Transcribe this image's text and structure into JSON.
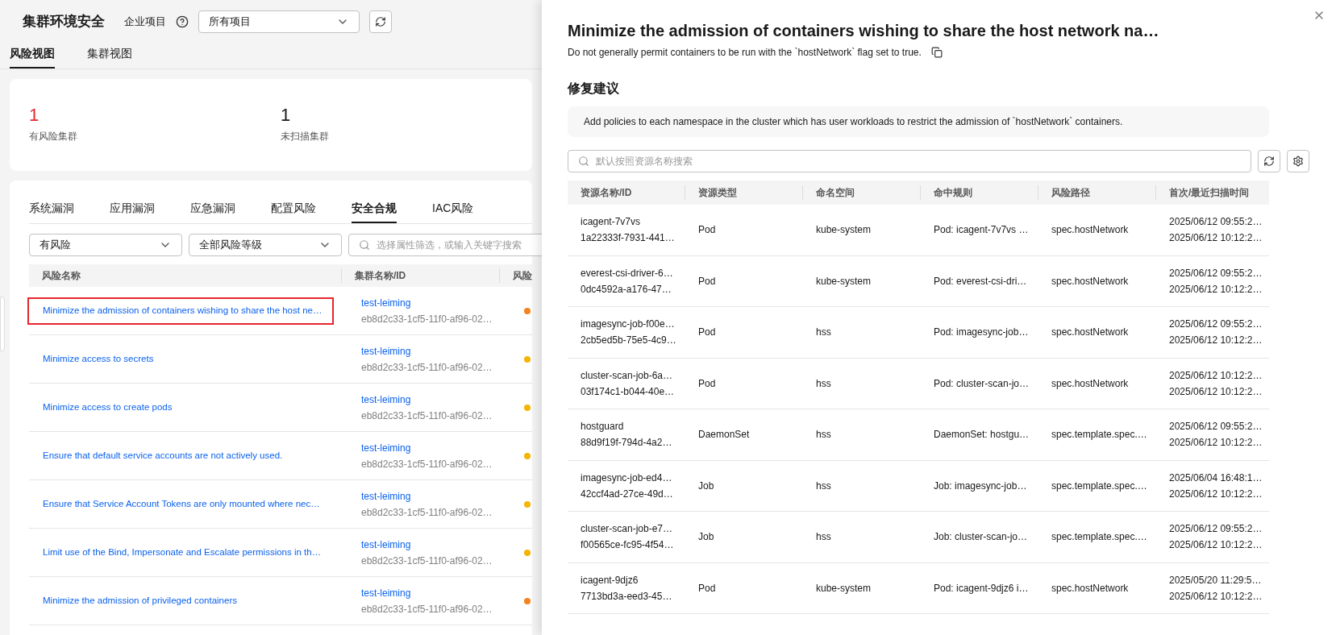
{
  "header": {
    "title": "集群环境安全",
    "project_label": "企业项目",
    "project_select": "所有项目"
  },
  "view_tabs": [
    {
      "label": "风险视图",
      "selected": true
    },
    {
      "label": "集群视图",
      "selected": false
    }
  ],
  "stats": [
    {
      "value": "1",
      "label": "有风险集群",
      "alert": true
    },
    {
      "value": "1",
      "label": "未扫描集群",
      "alert": false
    }
  ],
  "risk_tabs": [
    {
      "label": "系统漏洞",
      "selected": false
    },
    {
      "label": "应用漏洞",
      "selected": false
    },
    {
      "label": "应急漏洞",
      "selected": false
    },
    {
      "label": "配置风险",
      "selected": false
    },
    {
      "label": "安全合规",
      "selected": true
    },
    {
      "label": "IAC风险",
      "selected": false
    }
  ],
  "filters": {
    "status": "有风险",
    "level": "全部风险等级",
    "search_placeholder": "选择属性筛选，或输入关键字搜索"
  },
  "risk_table": {
    "columns": [
      "风险名称",
      "集群名称/ID",
      "风险"
    ],
    "rows": [
      {
        "name": "Minimize the admission of containers wishing to share the host ne…",
        "cluster": "test-leiming",
        "cluster_id": "eb8d2c33-1cf5-11f0-af96-02…",
        "color": "#f5821f",
        "highlighted": true
      },
      {
        "name": "Minimize access to secrets",
        "cluster": "test-leiming",
        "cluster_id": "eb8d2c33-1cf5-11f0-af96-02…",
        "color": "#f5b400",
        "highlighted": false
      },
      {
        "name": "Minimize access to create pods",
        "cluster": "test-leiming",
        "cluster_id": "eb8d2c33-1cf5-11f0-af96-02…",
        "color": "#f5b400",
        "highlighted": false
      },
      {
        "name": "Ensure that default service accounts are not actively used.",
        "cluster": "test-leiming",
        "cluster_id": "eb8d2c33-1cf5-11f0-af96-02…",
        "color": "#f5b400",
        "highlighted": false
      },
      {
        "name": "Ensure that Service Account Tokens are only mounted where nec…",
        "cluster": "test-leiming",
        "cluster_id": "eb8d2c33-1cf5-11f0-af96-02…",
        "color": "#f5b400",
        "highlighted": false
      },
      {
        "name": "Limit use of the Bind, Impersonate and Escalate permissions in th…",
        "cluster": "test-leiming",
        "cluster_id": "eb8d2c33-1cf5-11f0-af96-02…",
        "color": "#f5b400",
        "highlighted": false
      },
      {
        "name": "Minimize the admission of privileged containers",
        "cluster": "test-leiming",
        "cluster_id": "eb8d2c33-1cf5-11f0-af96-02…",
        "color": "#f5821f",
        "highlighted": false
      }
    ]
  },
  "drawer": {
    "title": "Minimize the admission of containers wishing to share the host network na…",
    "description": "Do not generally permit containers to be run with the `hostNetwork` flag set to true.",
    "section_title": "修复建议",
    "suggestion": "Add policies to each namespace in the cluster which has user workloads to restrict the admission of `hostNetwork` containers.",
    "search_placeholder": "默认按照资源名称搜索",
    "table": {
      "columns": [
        "资源名称/ID",
        "资源类型",
        "命名空间",
        "命中规则",
        "风险路径",
        "首次/最近扫描时间"
      ],
      "rows": [
        {
          "name": "icagent-7v7vs",
          "id": "1a22333f-7931-441…",
          "type": "Pod",
          "namespace": "kube-system",
          "rule": "Pod: icagent-7v7vs …",
          "path": "spec.hostNetwork",
          "first_scan": "2025/06/12 09:55:2…",
          "last_scan": "2025/06/12 10:12:2…"
        },
        {
          "name": "everest-csi-driver-6…",
          "id": "0dc4592a-a176-47…",
          "type": "Pod",
          "namespace": "kube-system",
          "rule": "Pod: everest-csi-dri…",
          "path": "spec.hostNetwork",
          "first_scan": "2025/06/12 09:55:2…",
          "last_scan": "2025/06/12 10:12:2…"
        },
        {
          "name": "imagesync-job-f00e…",
          "id": "2cb5ed5b-75e5-4c9…",
          "type": "Pod",
          "namespace": "hss",
          "rule": "Pod: imagesync-job…",
          "path": "spec.hostNetwork",
          "first_scan": "2025/06/12 09:55:2…",
          "last_scan": "2025/06/12 10:12:2…"
        },
        {
          "name": "cluster-scan-job-6a…",
          "id": "03f174c1-b044-40e…",
          "type": "Pod",
          "namespace": "hss",
          "rule": "Pod: cluster-scan-jo…",
          "path": "spec.hostNetwork",
          "first_scan": "2025/06/12 10:12:2…",
          "last_scan": "2025/06/12 10:12:2…"
        },
        {
          "name": "hostguard",
          "id": "88d9f19f-794d-4a2…",
          "type": "DaemonSet",
          "namespace": "hss",
          "rule": "DaemonSet: hostgu…",
          "path": "spec.template.spec.…",
          "first_scan": "2025/06/12 09:55:2…",
          "last_scan": "2025/06/12 10:12:2…"
        },
        {
          "name": "imagesync-job-ed4…",
          "id": "42ccf4ad-27ce-49d…",
          "type": "Job",
          "namespace": "hss",
          "rule": "Job: imagesync-job…",
          "path": "spec.template.spec.…",
          "first_scan": "2025/06/04 16:48:1…",
          "last_scan": "2025/06/12 10:12:2…"
        },
        {
          "name": "cluster-scan-job-e7…",
          "id": "f00565ce-fc95-4f54…",
          "type": "Job",
          "namespace": "hss",
          "rule": "Job: cluster-scan-jo…",
          "path": "spec.template.spec.…",
          "first_scan": "2025/06/12 09:55:2…",
          "last_scan": "2025/06/12 10:12:2…"
        },
        {
          "name": "icagent-9djz6",
          "id": "7713bd3a-eed3-45…",
          "type": "Pod",
          "namespace": "kube-system",
          "rule": "Pod: icagent-9djz6 i…",
          "path": "spec.hostNetwork",
          "first_scan": "2025/05/20 11:29:5…",
          "last_scan": "2025/06/12 10:12:2…"
        }
      ]
    }
  }
}
